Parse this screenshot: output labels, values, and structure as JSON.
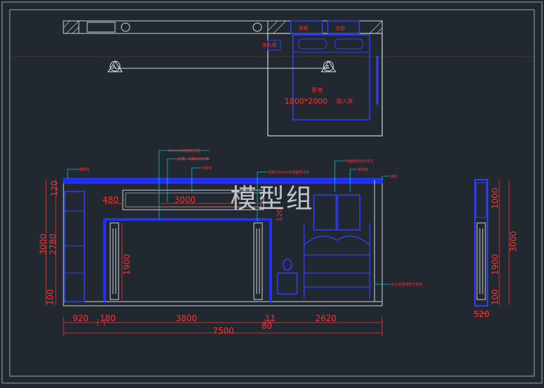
{
  "drawing": {
    "watermark": "模型组",
    "plan": {
      "bed_label": "1800*2000",
      "bed_label_suffix": "双人床",
      "room_label": "卧室",
      "tags": [
        "衣柜",
        "衣柜",
        "床头柜"
      ],
      "section_markers": [
        "A",
        "A"
      ]
    },
    "elevation": {
      "annotations": [
        "80mm木饰面板造型",
        "灯槽，内藏LED灯带",
        "石膏线",
        "踢脚线",
        "定制180mm木饰面罗马柱",
        "墙面硬包软包布艺",
        "装饰画",
        "墙纸",
        "床头背景墙布艺软包"
      ],
      "dims_top": [
        "120",
        "480",
        "3000"
      ],
      "dims_left_outer": [
        "3000"
      ],
      "dims_left_inner": [
        "2780",
        "100"
      ],
      "dims_left_top": [
        "120"
      ],
      "dim_inside_door": "1900",
      "dims_bottom": [
        "920",
        "180",
        "3800",
        "11",
        "2620"
      ],
      "dim_bottom_extra": "80",
      "dim_total": "7500"
    },
    "side": {
      "dims_right_inner": [
        "1000",
        "1900",
        "100"
      ],
      "dim_right_outer": "3000",
      "dim_bottom": "520"
    }
  }
}
